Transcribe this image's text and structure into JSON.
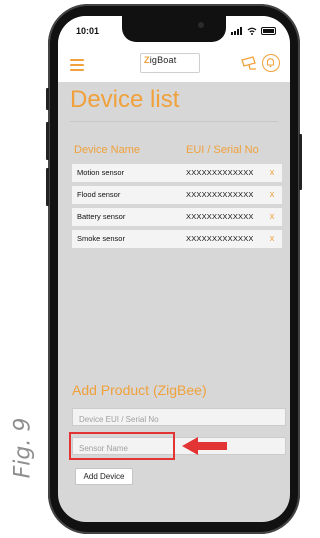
{
  "figure_label": "Fig. 9",
  "status_bar": {
    "time": "10:01"
  },
  "app": {
    "logo_prefix": "Z",
    "logo_text": "igBoat"
  },
  "page_title": "Device list",
  "table": {
    "headers": [
      "Device Name",
      "EUI / Serial No"
    ],
    "rows": [
      {
        "name": "Motion sensor",
        "serial": "XXXXXXXXXXXXX",
        "remove": "x"
      },
      {
        "name": "Flood sensor",
        "serial": "XXXXXXXXXXXXX",
        "remove": "x"
      },
      {
        "name": "Battery sensor",
        "serial": "XXXXXXXXXXXXX",
        "remove": "x"
      },
      {
        "name": "Smoke sensor",
        "serial": "XXXXXXXXXXXXX",
        "remove": "x"
      }
    ]
  },
  "add_product": {
    "title": "Add Product (ZigBee)",
    "eui_placeholder": "Device EUI / Serial No",
    "name_placeholder": "Sensor Name",
    "button_label": "Add Device"
  },
  "colors": {
    "accent": "#f0a13b",
    "highlight": "#e23434",
    "screen_bg": "#d7d7d7"
  },
  "icons": [
    "menu-icon",
    "camera-icon",
    "bell-icon",
    "arrow-icon"
  ]
}
